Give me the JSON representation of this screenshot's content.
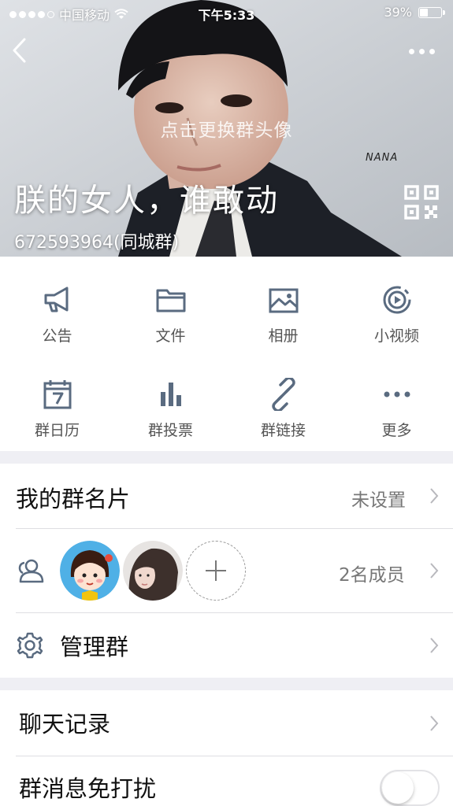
{
  "status_bar": {
    "carrier": "中国移动",
    "time": "下午5:33",
    "battery_text": "39%",
    "battery_level": 0.39
  },
  "header": {
    "change_avatar_hint": "点击更换群头像",
    "watermark": "NANA",
    "group_name": "朕的女人，谁敢动",
    "group_id": "672593964(同城群)"
  },
  "functions": [
    {
      "label": "公告",
      "icon": "megaphone-icon"
    },
    {
      "label": "文件",
      "icon": "folder-icon"
    },
    {
      "label": "相册",
      "icon": "photo-album-icon"
    },
    {
      "label": "小视频",
      "icon": "video-play-icon"
    },
    {
      "label": "群日历",
      "icon": "calendar-icon"
    },
    {
      "label": "群投票",
      "icon": "bar-chart-icon"
    },
    {
      "label": "群链接",
      "icon": "link-icon"
    },
    {
      "label": "更多",
      "icon": "more-dots-icon"
    }
  ],
  "my_card": {
    "title": "我的群名片",
    "value": "未设置"
  },
  "members": {
    "count_text": "2名成员",
    "icon": "members-icon"
  },
  "manage": {
    "title": "管理群",
    "icon": "gear-icon"
  },
  "chat_history": {
    "title": "聊天记录"
  },
  "mute": {
    "title": "群消息免打扰",
    "enabled": false
  },
  "colors": {
    "accent": "#5a6b80",
    "separator": "#efeff4",
    "text_secondary": "#777777"
  }
}
